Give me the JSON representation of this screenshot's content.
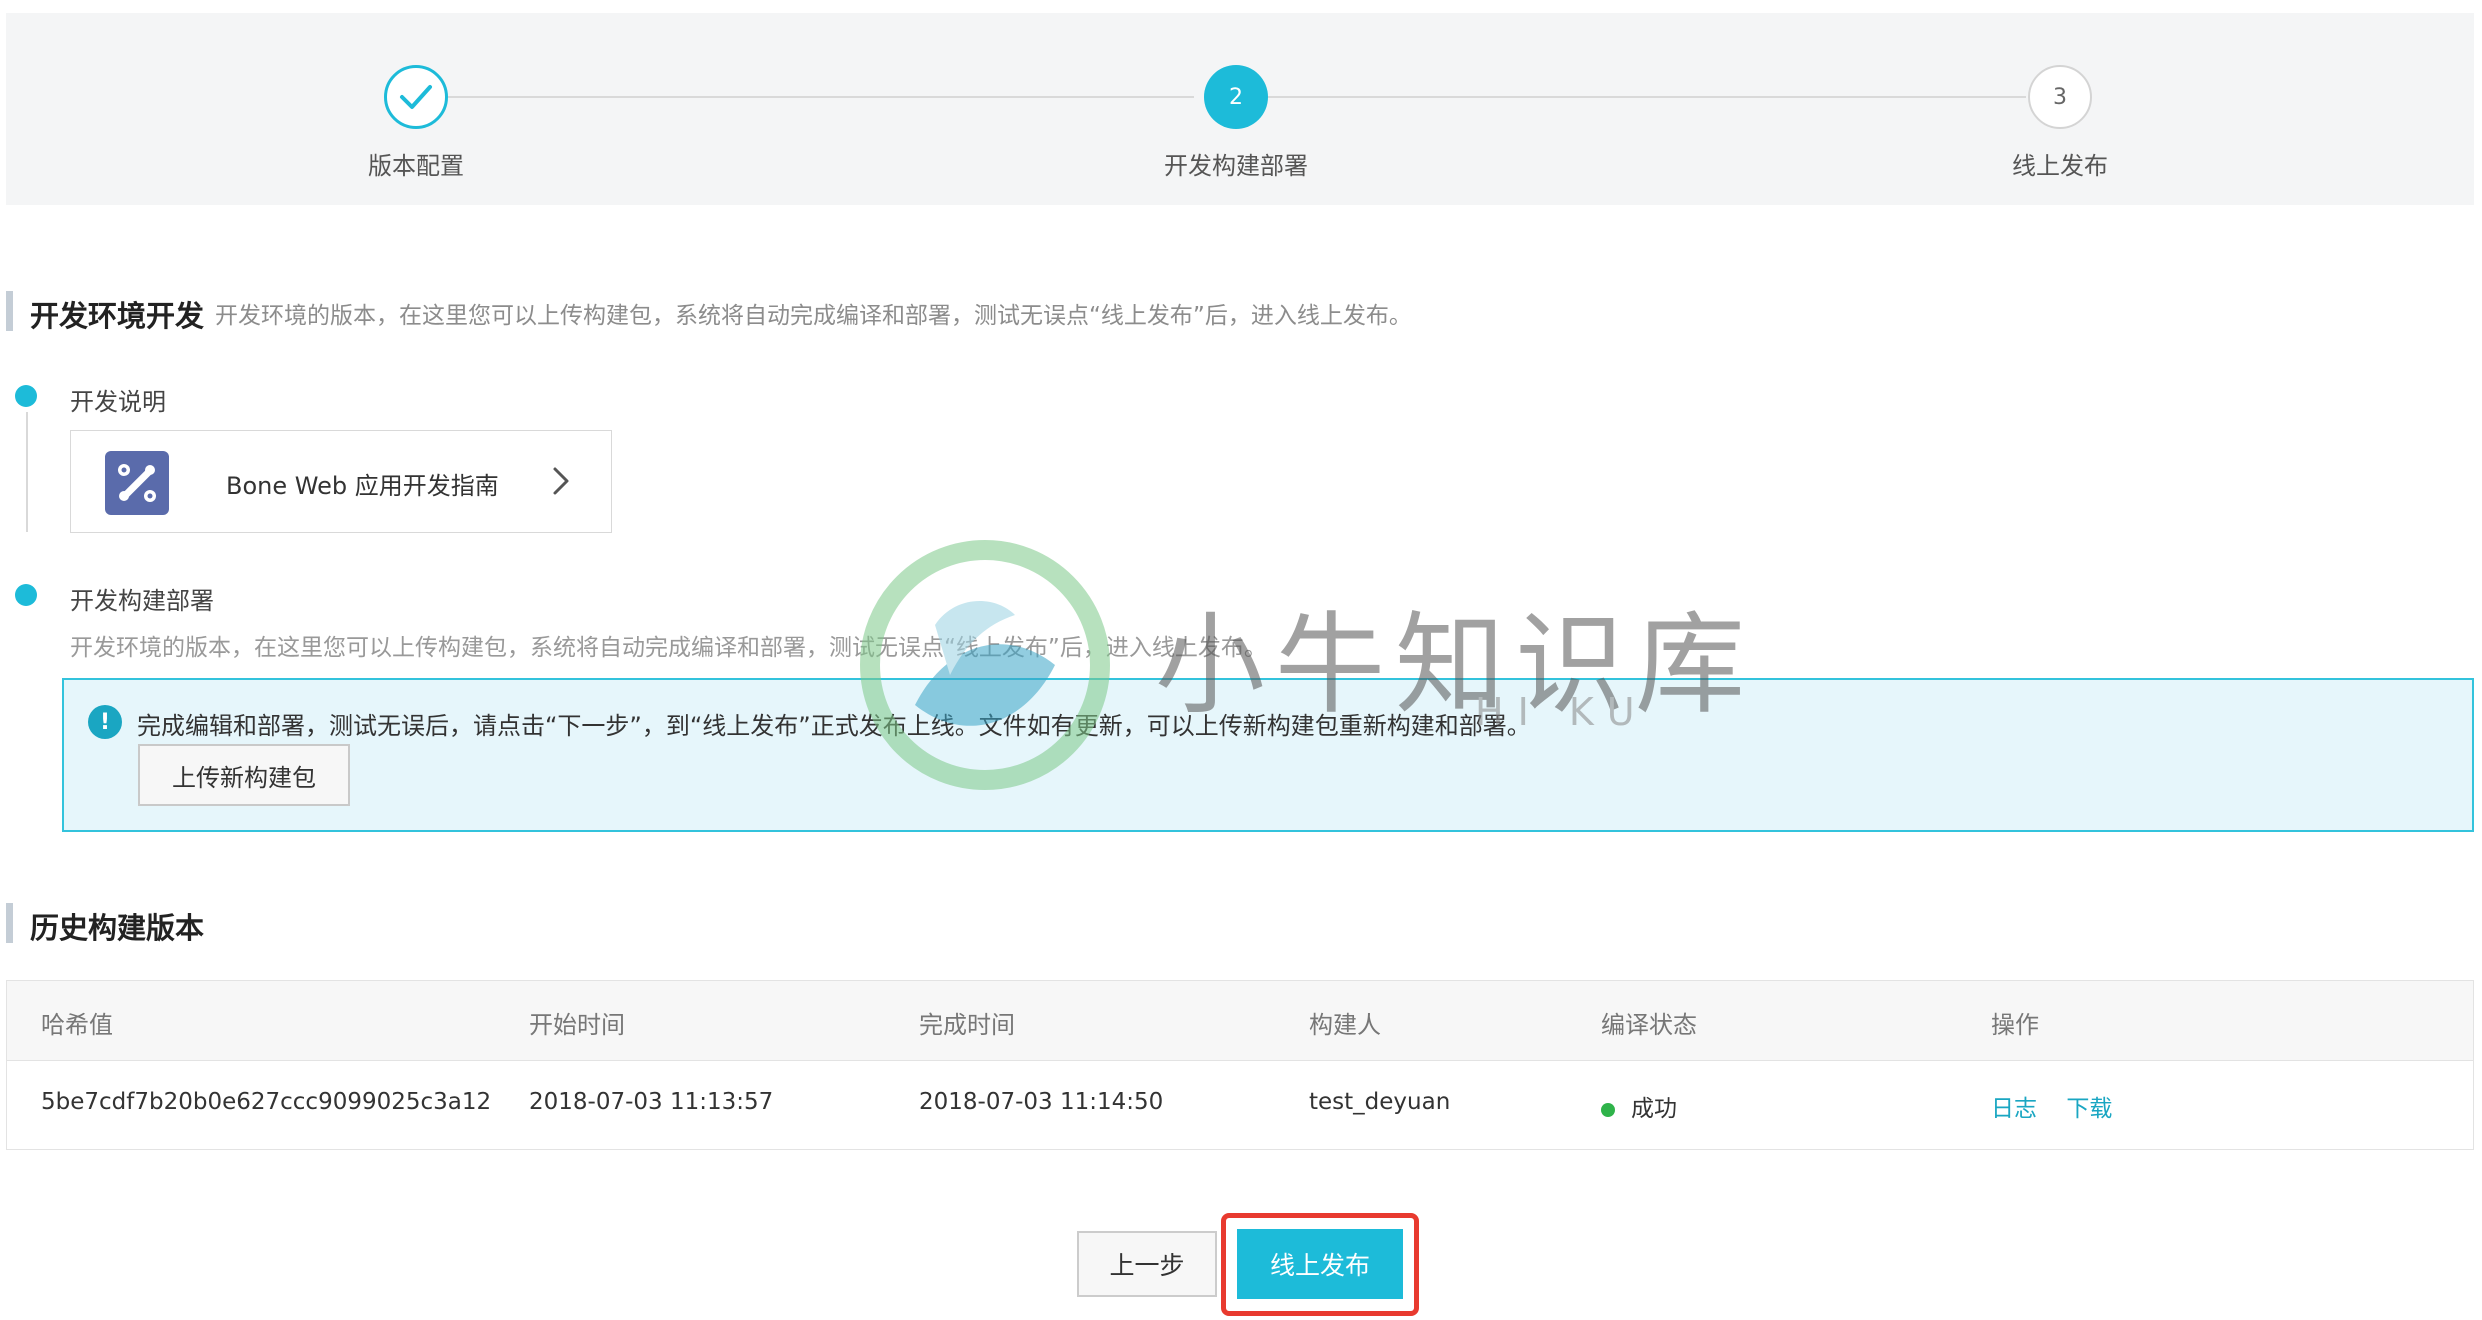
{
  "stepper": {
    "steps": [
      {
        "label": "版本配置",
        "state": "done",
        "number": ""
      },
      {
        "label": "开发构建部署",
        "state": "active",
        "number": "2"
      },
      {
        "label": "线上发布",
        "state": "todo",
        "number": "3"
      }
    ]
  },
  "dev_section": {
    "title": "开发环境开发",
    "description": "开发环境的版本，在这里您可以上传构建包，系统将自动完成编译和部署，测试无误点“线上发布”后，进入线上发布。",
    "guide": {
      "heading": "开发说明",
      "card_label": "Bone Web 应用开发指南",
      "logo_icon": "wrench-puzzle-icon",
      "chevron_icon": "chevron-right-icon"
    },
    "build": {
      "heading": "开发构建部署",
      "description": "开发环境的版本，在这里您可以上传构建包，系统将自动完成编译和部署，测试无误点“线上发布”后，进入线上发布。",
      "alert_text": "完成编辑和部署，测试无误后，请点击“下一步”，到“线上发布”正式发布上线。文件如有更新，可以上传新构建包重新构建和部署。",
      "alert_icon": "info-icon",
      "upload_button": "上传新构建包"
    }
  },
  "history_section": {
    "title": "历史构建版本",
    "columns": [
      "哈希值",
      "开始时间",
      "完成时间",
      "构建人",
      "编译状态",
      "操作"
    ],
    "rows": [
      {
        "hash": "5be7cdf7b20b0e627ccc9099025c3a12",
        "start": "2018-07-03 11:13:57",
        "end": "2018-07-03 11:14:50",
        "builder": "test_deyuan",
        "status": "成功",
        "actions": [
          "日志",
          "下载"
        ]
      }
    ]
  },
  "footer": {
    "prev_button": "上一步",
    "publish_button": "线上发布"
  },
  "watermark": {
    "text": "小牛知识库",
    "sub": "HI KU"
  },
  "colors": {
    "accent": "#1dbbd9",
    "success": "#2fb34a",
    "highlight": "#e83a2f",
    "alert_bg": "#e6f6fb"
  }
}
